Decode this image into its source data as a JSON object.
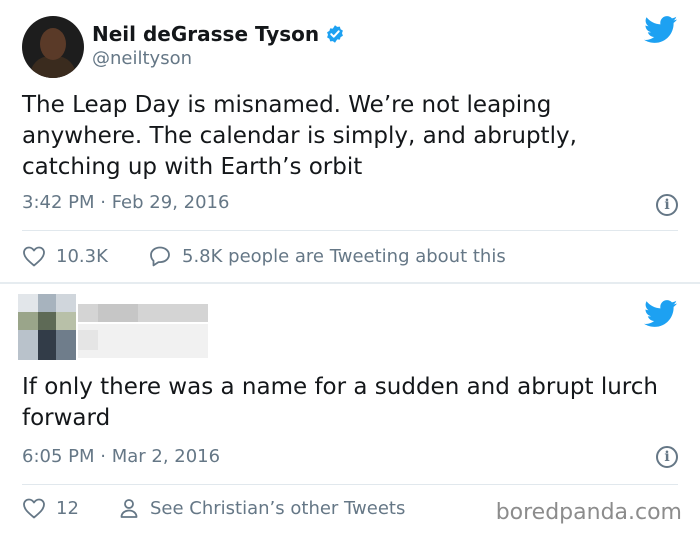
{
  "tweet1": {
    "name": "Neil deGrasse Tyson",
    "handle": "@neiltyson",
    "text": "The Leap Day is misnamed. We’re not leaping anywhere. The calendar is simply, and abruptly, catching up with Earth’s orbit",
    "timestamp": "3:42 PM · Feb 29, 2016",
    "likes": "10.3K",
    "retweets_text": "5.8K people are Tweeting about this"
  },
  "tweet2": {
    "text": "If only there was a name for a sudden and abrupt lurch forward",
    "timestamp": "6:05 PM · Mar 2, 2016",
    "likes": "12",
    "profile_link": "See Christian’s other Tweets"
  },
  "watermark": "boredpanda.com",
  "colors": {
    "twitter_blue": "#1da1f2",
    "secondary_text": "#657786",
    "divider": "#e1e8ed"
  },
  "icons": [
    "verified-badge-icon",
    "twitter-bird-icon",
    "info-icon",
    "heart-icon",
    "speech-bubble-icon",
    "person-icon"
  ]
}
